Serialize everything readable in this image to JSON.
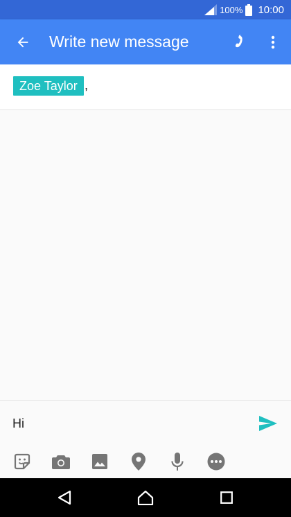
{
  "status_bar": {
    "battery": "100%",
    "time": "10:00"
  },
  "app_bar": {
    "title": "Write new message"
  },
  "recipients": [
    {
      "name": "Zoe Taylor"
    }
  ],
  "recipient_separator": ",",
  "compose": {
    "value": "Hi"
  },
  "icons": {
    "back": "arrow-left",
    "call": "phone",
    "more": "vertical-dots",
    "send": "paper-plane",
    "attachments": [
      "sticker",
      "camera",
      "image",
      "location-pin",
      "microphone",
      "more-horizontal"
    ],
    "nav": [
      "back-triangle",
      "home",
      "recent-apps"
    ]
  },
  "colors": {
    "status_bar": "#3367d6",
    "app_bar": "#4285f4",
    "chip": "#1fbfc0",
    "send": "#1fbfc0",
    "attach_icons": "#757575"
  }
}
